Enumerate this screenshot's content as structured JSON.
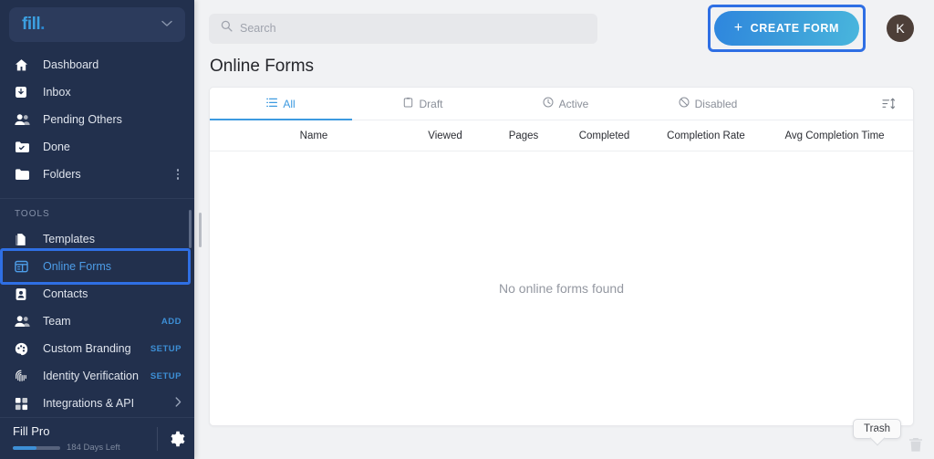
{
  "sidebar": {
    "brand": {
      "logo_text": "fill",
      "logo_dot": ".",
      "chevron": "chevron-down"
    },
    "items": [
      {
        "label": "Dashboard",
        "icon": "home-icon"
      },
      {
        "label": "Inbox",
        "icon": "inbox-icon"
      },
      {
        "label": "Pending Others",
        "icon": "people-icon"
      },
      {
        "label": "Done",
        "icon": "folder-check-icon"
      },
      {
        "label": "Folders",
        "icon": "folder-icon",
        "trailing": "kebab-menu-icon"
      }
    ],
    "section_title": "TOOLS",
    "tools": [
      {
        "label": "Templates",
        "icon": "template-icon"
      },
      {
        "label": "Online Forms",
        "icon": "online-forms-icon",
        "selected": true
      },
      {
        "label": "Contacts",
        "icon": "contact-card-icon"
      },
      {
        "label": "Team",
        "icon": "team-icon",
        "action": "ADD"
      },
      {
        "label": "Custom Branding",
        "icon": "palette-icon",
        "action": "SETUP"
      },
      {
        "label": "Identity Verification",
        "icon": "fingerprint-icon",
        "action": "SETUP"
      },
      {
        "label": "Integrations & API",
        "icon": "puzzle-icon",
        "trailing": "chevron-right-icon"
      }
    ],
    "footer": {
      "plan": "Fill Pro",
      "days_left": "184 Days Left",
      "progress_percent": 50,
      "settings_icon": "gear-icon"
    },
    "colors": {
      "background": "#22304d",
      "accent": "#3d8fd6",
      "selected_text": "#4d9de8",
      "focus_ring": "#2f6fe4"
    }
  },
  "topbar": {
    "search": {
      "placeholder": "Search",
      "value": "Search",
      "icon": "search-icon"
    },
    "create_button": {
      "label": "CREATE FORM",
      "icon": "plus-icon",
      "focused": true
    },
    "avatar": {
      "initial": "K",
      "color": "#4d3f38"
    }
  },
  "main": {
    "page_title": "Online Forms",
    "tabs": [
      {
        "label": "All",
        "icon": "list-icon",
        "active": true
      },
      {
        "label": "Draft",
        "icon": "clipboard-icon",
        "active": false
      },
      {
        "label": "Active",
        "icon": "clock-icon",
        "active": false
      },
      {
        "label": "Disabled",
        "icon": "ban-icon",
        "active": false
      }
    ],
    "sort_icon": "sort-icon",
    "table": {
      "columns": [
        "Name",
        "Viewed",
        "Pages",
        "Completed",
        "Completion Rate",
        "Avg Completion Time"
      ]
    },
    "empty_state": "No online forms found"
  },
  "overlay": {
    "trash_tooltip": "Trash",
    "trash_icon": "trash-icon"
  }
}
